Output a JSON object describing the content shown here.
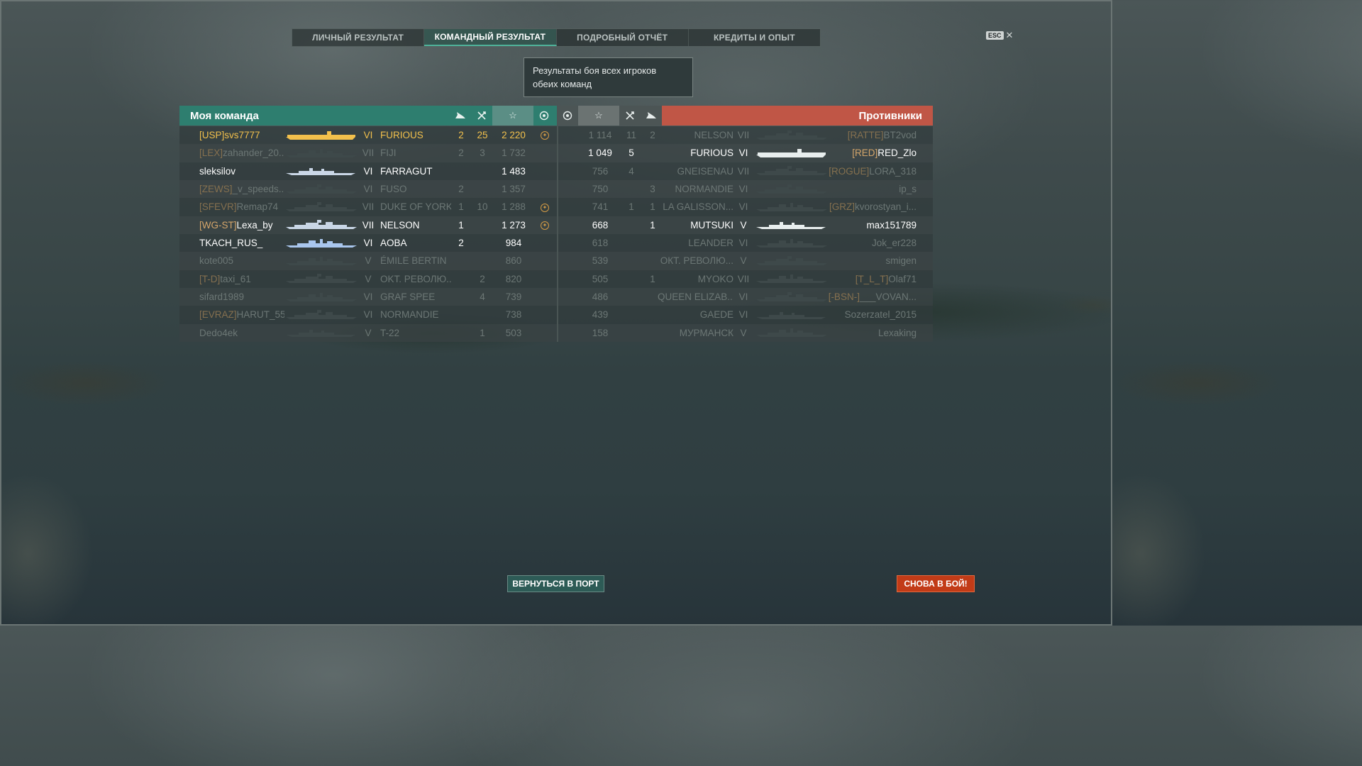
{
  "tabs": [
    "ЛИЧНЫЙ РЕЗУЛЬТАТ",
    "КОМАНДНЫЙ РЕЗУЛЬТАТ",
    "ПОДРОБНЫЙ ОТЧЁТ",
    "КРЕДИТЫ И ОПЫТ"
  ],
  "active_tab": 1,
  "esc": {
    "key": "ESC",
    "close": "✕"
  },
  "tooltip": "Результаты боя всех игроков обеих команд",
  "my_team": {
    "title": "Моя команда",
    "header_icons": [
      "ship-kill-icon",
      "plane-kill-icon",
      "star-icon",
      "medal-icon"
    ],
    "rows": [
      {
        "clan": "[USP]",
        "name": "svs7777",
        "tier": "VI",
        "ship": "FURIOUS",
        "ship_type": "carrier",
        "ships": "2",
        "planes": "25",
        "xp": "2 220",
        "medal": true,
        "state": "self"
      },
      {
        "clan": "[LEX]",
        "name": "zahander_20...",
        "tier": "VII",
        "ship": "FIJI",
        "ship_type": "cruiser",
        "ships": "2",
        "planes": "3",
        "xp": "1 732",
        "medal": false,
        "state": "dead"
      },
      {
        "clan": "",
        "name": "sleksilov",
        "tier": "VI",
        "ship": "FARRAGUT",
        "ship_type": "destroyer",
        "ships": "",
        "planes": "",
        "xp": "1 483",
        "medal": false,
        "state": "alive"
      },
      {
        "clan": "[ZEWS]",
        "name": "_v_speeds...",
        "tier": "VI",
        "ship": "FUSO",
        "ship_type": "battleship",
        "ships": "2",
        "planes": "",
        "xp": "1 357",
        "medal": false,
        "state": "dead"
      },
      {
        "clan": "[SFEVR]",
        "name": "Remap74",
        "tier": "VII",
        "ship": "DUKE OF YORK",
        "ship_type": "battleship",
        "ships": "1",
        "planes": "10",
        "xp": "1 288",
        "medal": true,
        "state": "dead"
      },
      {
        "clan": "[WG-ST]",
        "name": "Lexa_by",
        "tier": "VII",
        "ship": "NELSON",
        "ship_type": "battleship",
        "ships": "1",
        "planes": "",
        "xp": "1 273",
        "medal": true,
        "state": "alive"
      },
      {
        "clan": "",
        "name": "TKACH_RUS_",
        "tier": "VI",
        "ship": "AOBA",
        "ship_type": "cruiser",
        "ships": "2",
        "planes": "",
        "xp": "984",
        "medal": false,
        "state": "alive"
      },
      {
        "clan": "",
        "name": "kote005",
        "tier": "V",
        "ship": "ÉMILE BERTIN",
        "ship_type": "cruiser",
        "ships": "",
        "planes": "",
        "xp": "860",
        "medal": false,
        "state": "dead"
      },
      {
        "clan": "[T-D]",
        "name": "taxi_61",
        "tier": "V",
        "ship": "OKT. РЕВОЛЮ...",
        "ship_type": "battleship",
        "ships": "",
        "planes": "2",
        "xp": "820",
        "medal": false,
        "state": "dead"
      },
      {
        "clan": "",
        "name": "sifard1989",
        "tier": "VI",
        "ship": "GRAF SPEE",
        "ship_type": "cruiser",
        "ships": "",
        "planes": "4",
        "xp": "739",
        "medal": false,
        "state": "dead"
      },
      {
        "clan": "[EVRAZ]",
        "name": "HARUT_558",
        "tier": "VI",
        "ship": "NORMANDIE",
        "ship_type": "battleship",
        "ships": "",
        "planes": "",
        "xp": "738",
        "medal": false,
        "state": "dead"
      },
      {
        "clan": "",
        "name": "Dedo4ek",
        "tier": "V",
        "ship": "T-22",
        "ship_type": "destroyer",
        "ships": "",
        "planes": "1",
        "xp": "503",
        "medal": false,
        "state": "dead"
      }
    ]
  },
  "enemy_team": {
    "title": "Противники",
    "header_icons": [
      "medal-icon",
      "star-icon",
      "plane-kill-icon",
      "ship-kill-icon"
    ],
    "rows": [
      {
        "clan": "[RATTE]",
        "name": "BT2vod",
        "tier": "VII",
        "ship": "NELSON",
        "ship_type": "battleship",
        "ships": "2",
        "planes": "11",
        "xp": "1 114",
        "medal": false,
        "state": "dead"
      },
      {
        "clan": "[RED]",
        "name": "RED_Zlo",
        "tier": "VI",
        "ship": "FURIOUS",
        "ship_type": "carrier",
        "ships": "",
        "planes": "5",
        "xp": "1 049",
        "medal": false,
        "state": "alive"
      },
      {
        "clan": "[ROGUE]",
        "name": "LORA_318",
        "tier": "VII",
        "ship": "GNEISENAU",
        "ship_type": "battleship",
        "ships": "",
        "planes": "4",
        "xp": "756",
        "medal": false,
        "state": "dead"
      },
      {
        "clan": "",
        "name": "ip_s",
        "tier": "VI",
        "ship": "NORMANDIE",
        "ship_type": "battleship",
        "ships": "3",
        "planes": "",
        "xp": "750",
        "medal": false,
        "state": "dead"
      },
      {
        "clan": "[GRZ]",
        "name": "kvorostyan_i...",
        "tier": "VI",
        "ship": "LA GALISSON...",
        "ship_type": "cruiser",
        "ships": "1",
        "planes": "1",
        "xp": "741",
        "medal": false,
        "state": "dead"
      },
      {
        "clan": "",
        "name": "max151789",
        "tier": "V",
        "ship": "MUTSUKI",
        "ship_type": "destroyer",
        "ships": "1",
        "planes": "",
        "xp": "668",
        "medal": false,
        "state": "alive"
      },
      {
        "clan": "",
        "name": "Jok_er228",
        "tier": "VI",
        "ship": "LEANDER",
        "ship_type": "cruiser",
        "ships": "",
        "planes": "",
        "xp": "618",
        "medal": false,
        "state": "dead"
      },
      {
        "clan": "",
        "name": "smigen",
        "tier": "V",
        "ship": "ОКТ. РЕВОЛЮ...",
        "ship_type": "battleship",
        "ships": "",
        "planes": "",
        "xp": "539",
        "medal": false,
        "state": "dead"
      },
      {
        "clan": "[T_L_T]",
        "name": "Olaf71",
        "tier": "VII",
        "ship": "MYOKO",
        "ship_type": "cruiser",
        "ships": "1",
        "planes": "",
        "xp": "505",
        "medal": false,
        "state": "dead"
      },
      {
        "clan": "[-BSN-]",
        "name": "___VOVAN...",
        "tier": "VI",
        "ship": "QUEEN ELIZAB...",
        "ship_type": "battleship",
        "ships": "",
        "planes": "",
        "xp": "486",
        "medal": false,
        "state": "dead"
      },
      {
        "clan": "",
        "name": "Sozerzatel_2015",
        "tier": "VI",
        "ship": "GAEDE",
        "ship_type": "destroyer",
        "ships": "",
        "planes": "",
        "xp": "439",
        "medal": false,
        "state": "dead"
      },
      {
        "clan": "",
        "name": "Lexaking",
        "tier": "V",
        "ship": "МУРМАНСК",
        "ship_type": "cruiser",
        "ships": "",
        "planes": "",
        "xp": "158",
        "medal": false,
        "state": "dead"
      }
    ]
  },
  "buttons": {
    "port": "ВЕРНУТЬСЯ В ПОРТ",
    "battle": "СНОВА В БОЙ!"
  },
  "colors": {
    "my_team": "#2e7e6f",
    "enemy": "#c05646",
    "self_highlight": "#f2c04c",
    "clan": "#d5a56a",
    "battle_button": "#c23b17"
  }
}
